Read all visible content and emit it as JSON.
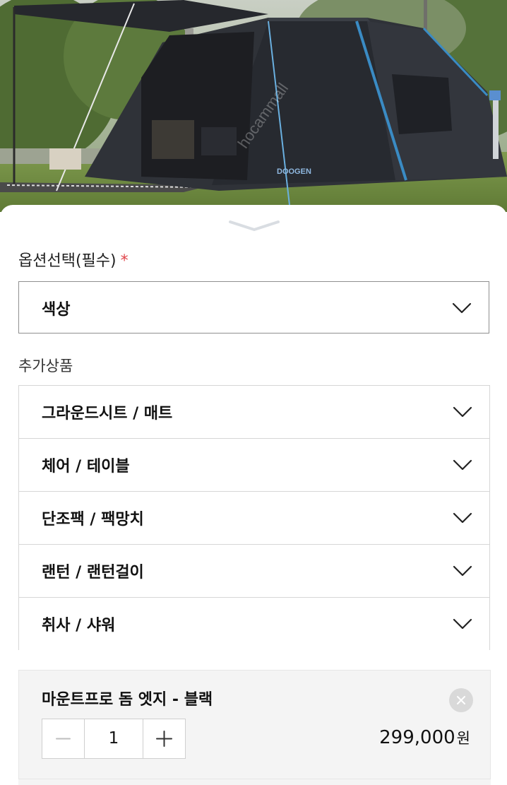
{
  "photo": {
    "brand_mark": "DOOGEN",
    "watermark": "hocammall"
  },
  "options": {
    "required_label": "옵션선택(필수)",
    "required_marker": "*",
    "color_select": {
      "value": "색상"
    }
  },
  "extras": {
    "label": "추가상품",
    "items": [
      {
        "label": "그라운드시트 / 매트"
      },
      {
        "label": "체어 / 테이블"
      },
      {
        "label": "단조팩 / 팩망치"
      },
      {
        "label": "랜턴 / 랜턴걸이"
      },
      {
        "label": "취사 / 샤워"
      }
    ]
  },
  "selected_product": {
    "name": "마운트프로 돔 엣지 - 블랙",
    "quantity": "1",
    "price": "299,000",
    "currency": "원"
  },
  "colors": {
    "required_star": "#e0454a",
    "select_border": "#8f8f8f",
    "card_bg": "#f4f4f4"
  },
  "icons": {
    "sheet_handle": "chevron-down-icon",
    "dropdown": "chevron-down-icon",
    "remove": "close-icon",
    "decrement": "minus-icon",
    "increment": "plus-icon"
  }
}
